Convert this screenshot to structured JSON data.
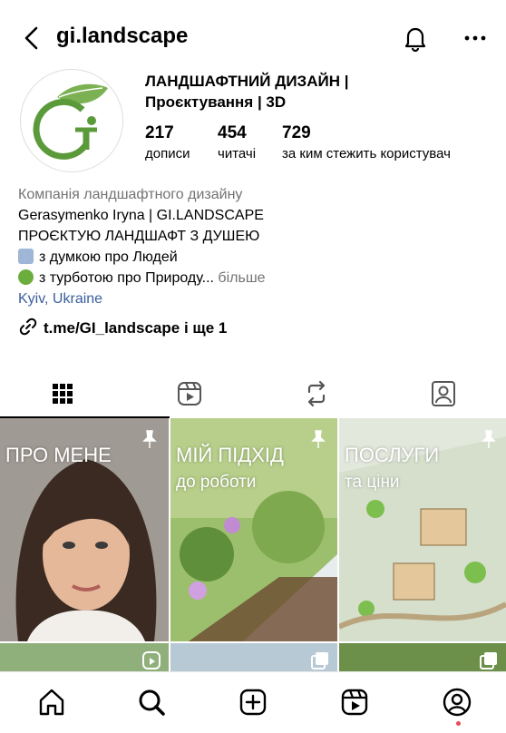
{
  "header": {
    "username": "gi.landscape"
  },
  "profile": {
    "display_name": "ЛАНДШАФТНИЙ ДИЗАЙН | Проєктування | 3D",
    "stats": [
      {
        "value": "217",
        "label": "дописи"
      },
      {
        "value": "454",
        "label": "читачі"
      },
      {
        "value": "729",
        "label": "за ким стежить користувач"
      }
    ],
    "logo_text": "Gi"
  },
  "bio": {
    "category": "Компанія ландшафтного дизайну",
    "line1": "Gerasymenko Iryna | GI.LANDSCAPE",
    "line2": "ПРОЄКТУЮ ЛАНДШАФТ З ДУШЕЮ",
    "line3": "з думкою про Людей",
    "line4": "з турботою про Природу...",
    "more": "більше",
    "location": "Kyiv, Ukraine",
    "external_link": "t.me/GI_landscape і ще 1"
  },
  "tabs": [
    "grid-icon",
    "reels-icon",
    "repost-icon",
    "tagged-icon"
  ],
  "grid": {
    "tiles": [
      {
        "title": "ПРО МЕНЕ",
        "subtitle": ""
      },
      {
        "title": "МІЙ ПІДХІД",
        "subtitle": "до роботи"
      },
      {
        "title": "ПОСЛУГИ",
        "subtitle": "та ціни"
      }
    ]
  },
  "bottom_nav": [
    "home-icon",
    "search-icon",
    "create-icon",
    "reels-icon",
    "profile-icon"
  ],
  "colors": {
    "link": "#3b5f9c",
    "muted": "#737373",
    "notification_dot": "#ed4956",
    "logo_green": "#6ca64a"
  }
}
